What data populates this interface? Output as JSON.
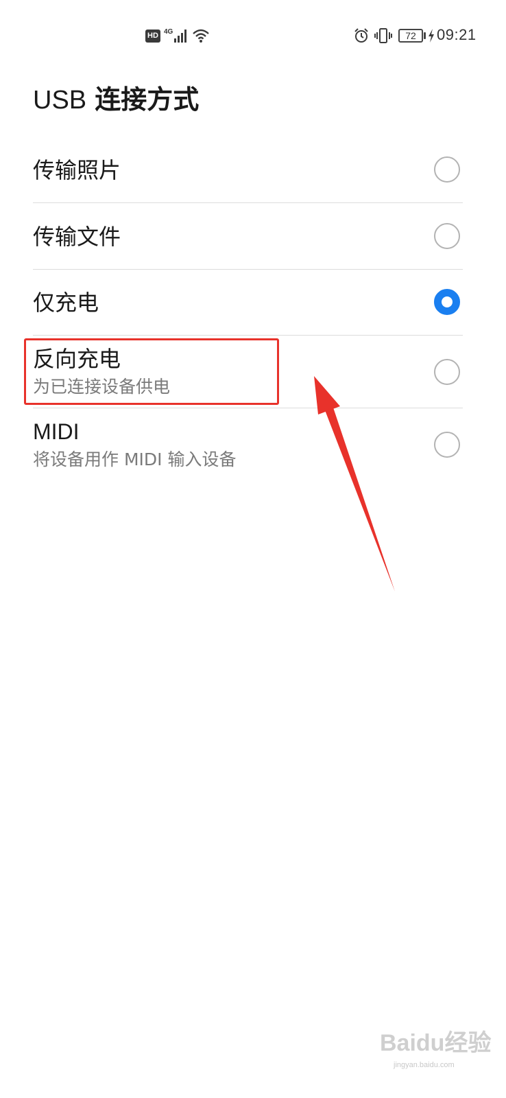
{
  "status_bar": {
    "hd_badge": "HD",
    "network_type": "4G",
    "battery_level": "72",
    "time": "09:21",
    "icons": [
      "hd-icon",
      "signal-icon",
      "wifi-icon",
      "alarm-icon",
      "vibrate-icon",
      "battery-icon",
      "charging-bolt-icon"
    ]
  },
  "header": {
    "title_prefix": "USB",
    "title_rest": "连接方式"
  },
  "options": [
    {
      "label": "传输照片",
      "selected": false
    },
    {
      "label": "传输文件",
      "selected": false
    },
    {
      "label": "仅充电",
      "selected": true
    },
    {
      "label": "反向充电",
      "description": "为已连接设备供电",
      "selected": false
    },
    {
      "label": "MIDI",
      "description": "将设备用作 MIDI 输入设备",
      "selected": false
    }
  ],
  "colors": {
    "accent": "#1a7ff0",
    "annotation": "#e8322b",
    "divider": "#dcdcdc",
    "subtext": "#7a7a7a"
  },
  "watermark": {
    "brand": "Baidu经验",
    "url": "jingyan.baidu.com"
  }
}
